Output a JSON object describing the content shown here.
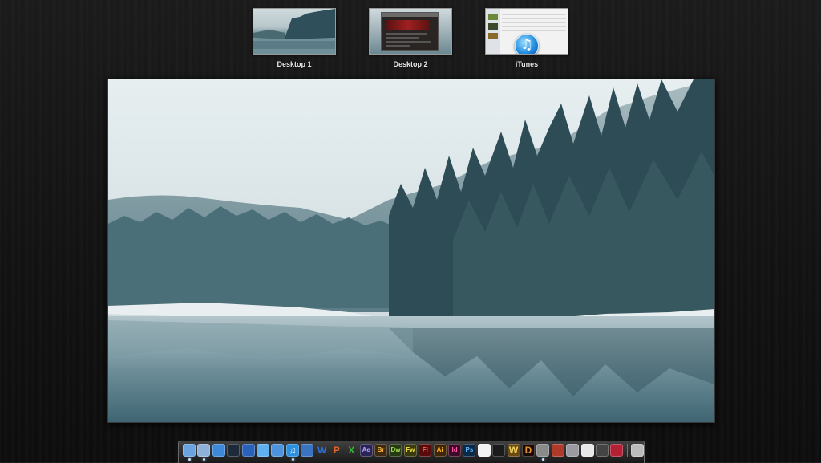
{
  "spaces": [
    {
      "label": "Desktop 1"
    },
    {
      "label": "Desktop 2"
    },
    {
      "label": "iTunes"
    }
  ],
  "main_preview": {
    "description_icon": "snowy-forest-lake-wallpaper"
  },
  "dock": {
    "items": [
      {
        "name": "finder-icon",
        "text": "",
        "bg": "#6aa3e0",
        "fg": "#fff",
        "running": true
      },
      {
        "name": "preview-icon",
        "text": "",
        "bg": "#8fb0d8",
        "fg": "#fff",
        "running": true
      },
      {
        "name": "safari-icon",
        "text": "",
        "bg": "#3d89d8",
        "fg": "#fff",
        "running": false
      },
      {
        "name": "quicktime-icon",
        "text": "",
        "bg": "#1e2a3a",
        "fg": "#fff",
        "running": false
      },
      {
        "name": "firefox-icon",
        "text": "",
        "bg": "#2a62b8",
        "fg": "#fff",
        "running": false
      },
      {
        "name": "ichat-icon",
        "text": "",
        "bg": "#5fb0ef",
        "fg": "#fff",
        "running": false
      },
      {
        "name": "mail-icon",
        "text": "",
        "bg": "#4d93de",
        "fg": "#fff",
        "running": false
      },
      {
        "name": "itunes-icon",
        "text": "♫",
        "bg": "#2d8fe0",
        "fg": "#fff",
        "running": true
      },
      {
        "name": "utility-icon",
        "text": "",
        "bg": "#3a74c0",
        "fg": "#fff",
        "running": false
      },
      {
        "name": "word-icon",
        "text": "W",
        "bg": "transparent",
        "fg": "#2f6fd8",
        "running": false
      },
      {
        "name": "powerpoint-icon",
        "text": "P",
        "bg": "transparent",
        "fg": "#e2662a",
        "running": false
      },
      {
        "name": "excel-icon",
        "text": "X",
        "bg": "transparent",
        "fg": "#3bb33b",
        "running": false
      },
      {
        "name": "after-effects-icon",
        "text": "Ae",
        "bg": "#2a2455",
        "fg": "#b9a9ff",
        "running": false
      },
      {
        "name": "bridge-icon",
        "text": "Br",
        "bg": "#3e2a10",
        "fg": "#f2b040",
        "running": false
      },
      {
        "name": "dreamweaver-icon",
        "text": "Dw",
        "bg": "#253a10",
        "fg": "#9fd84a",
        "running": false
      },
      {
        "name": "fireworks-icon",
        "text": "Fw",
        "bg": "#3a3a0a",
        "fg": "#f2e040",
        "running": false
      },
      {
        "name": "flash-icon",
        "text": "Fl",
        "bg": "#5a0c0c",
        "fg": "#ff6a5a",
        "running": false
      },
      {
        "name": "illustrator-icon",
        "text": "Ai",
        "bg": "#3e2608",
        "fg": "#ffb020",
        "running": false
      },
      {
        "name": "indesign-icon",
        "text": "Id",
        "bg": "#3e0a28",
        "fg": "#ff5aa8",
        "running": false
      },
      {
        "name": "photoshop-icon",
        "text": "Ps",
        "bg": "#0b2a48",
        "fg": "#5ab8ff",
        "running": false
      },
      {
        "name": "acrobat-icon",
        "text": "",
        "bg": "#f2f2f2",
        "fg": "#d02020",
        "running": false
      },
      {
        "name": "dvd-player-icon",
        "text": "",
        "bg": "#1a1a1a",
        "fg": "#fff",
        "running": false
      },
      {
        "name": "warcraft-icon",
        "text": "W",
        "bg": "#6a4a10",
        "fg": "#f2d060",
        "running": false
      },
      {
        "name": "diablo-icon",
        "text": "D",
        "bg": "#1a0a05",
        "fg": "#e0902a",
        "running": false
      },
      {
        "name": "hard-drive-icon",
        "text": "",
        "bg": "#8a8a8a",
        "fg": "#fff",
        "running": true
      },
      {
        "name": "game-icon",
        "text": "",
        "bg": "#b03a2a",
        "fg": "#fff",
        "running": false
      },
      {
        "name": "system-preferences-icon",
        "text": "",
        "bg": "#9a9aa0",
        "fg": "#fff",
        "running": false
      },
      {
        "name": "app-icon",
        "text": "",
        "bg": "#e8e8e8",
        "fg": "#333",
        "running": false
      },
      {
        "name": "dictionary-icon",
        "text": "",
        "bg": "#444",
        "fg": "#fff",
        "running": false
      },
      {
        "name": "flag-icon",
        "text": "",
        "bg": "#b22234",
        "fg": "#fff",
        "running": false
      },
      {
        "name": "trash-icon",
        "text": "",
        "bg": "#bbb",
        "fg": "#555",
        "running": false
      }
    ]
  }
}
